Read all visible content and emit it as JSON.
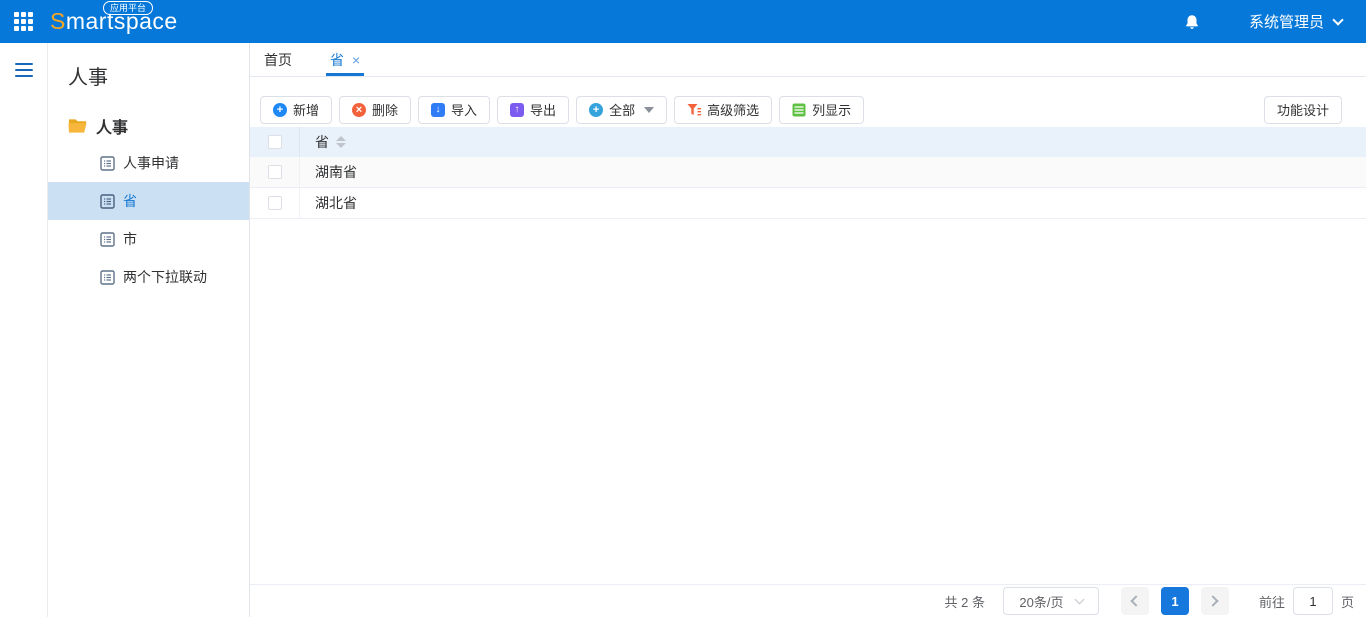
{
  "header": {
    "logo_s": "S",
    "logo_rest": "martspace",
    "logo_badge": "应用平台",
    "user_name": "系统管理员",
    "colors": {
      "header_bg": "#0578d9",
      "logo_s": "#f7a823"
    }
  },
  "sidebar": {
    "panel_title": "人事",
    "folder_label": "人事",
    "items": [
      {
        "label": "人事申请",
        "selected": false
      },
      {
        "label": "省",
        "selected": true
      },
      {
        "label": "市",
        "selected": false
      },
      {
        "label": "两个下拉联动",
        "selected": false
      }
    ],
    "colors": {
      "selected_bg": "#cce0f3",
      "selected_text": "#1678d2",
      "folder_icon": "#f6b73c"
    }
  },
  "tabs": [
    {
      "label": "首页",
      "active": false,
      "closable": false
    },
    {
      "label": "省",
      "active": true,
      "closable": true,
      "close_glyph": "×"
    }
  ],
  "toolbar": {
    "buttons": [
      {
        "label": "新增",
        "icon": "add-circle-icon",
        "icon_color": "#1e88f7",
        "icon_glyph": "+"
      },
      {
        "label": "删除",
        "icon": "delete-circle-icon",
        "icon_color": "#f4623c",
        "icon_glyph": "×"
      },
      {
        "label": "导入",
        "icon": "import-square-icon",
        "icon_color": "#2f7cf6",
        "icon_glyph": "↓"
      },
      {
        "label": "导出",
        "icon": "export-square-icon",
        "icon_color": "#7c5cf0",
        "icon_glyph": "↑"
      },
      {
        "label": "全部",
        "icon": "scope-circle-icon",
        "icon_color": "#35a3dc",
        "icon_glyph": "+",
        "has_caret": true
      },
      {
        "label": "高级筛选",
        "icon": "filter-funnel-icon",
        "icon_color": "#f4623c",
        "icon_glyph": "▼"
      },
      {
        "label": "列显示",
        "icon": "columns-table-icon",
        "icon_color": "#5fc142",
        "icon_glyph": "≡"
      }
    ],
    "design_button": "功能设计"
  },
  "table": {
    "columns": [
      {
        "label": "省",
        "sortable": true
      }
    ],
    "rows": [
      {
        "province": "湖南省"
      },
      {
        "province": "湖北省"
      }
    ],
    "colors": {
      "header_bg": "#e9f2fb",
      "row_border": "#ebeef5"
    }
  },
  "pagination": {
    "total_text": "共 2 条",
    "page_size_value": "20条/页",
    "current_page": "1",
    "goto_label": "前往",
    "goto_value": "1",
    "page_suffix": "页",
    "colors": {
      "active_page_bg": "#1678dd"
    }
  }
}
